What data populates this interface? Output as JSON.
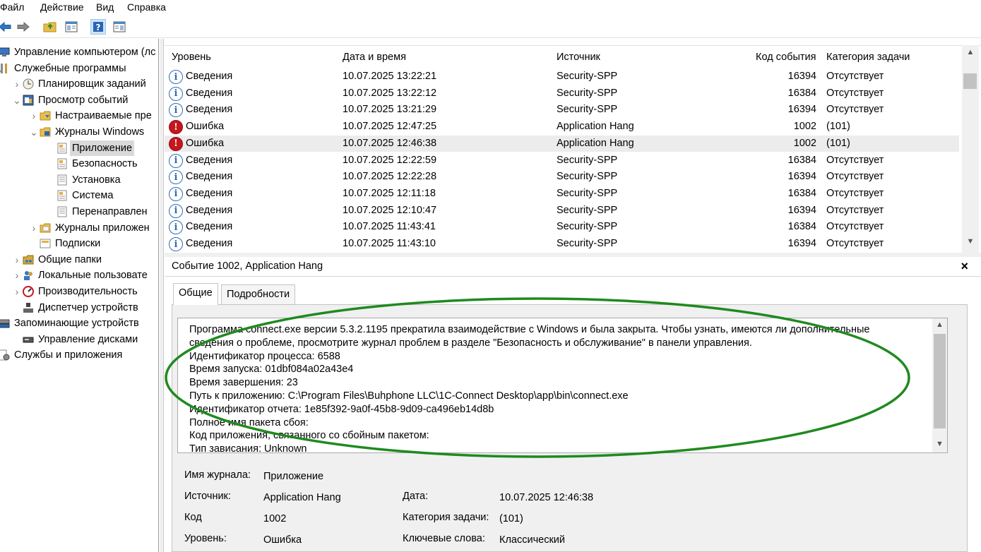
{
  "menu": [
    "Файл",
    "Действие",
    "Вид",
    "Справка"
  ],
  "tree": [
    {
      "label": "Управление компьютером (лс",
      "level": 0,
      "twisty": "",
      "icon": "computer-icon"
    },
    {
      "label": "Служебные программы",
      "level": 0,
      "twisty": "v",
      "icon": "tools-icon"
    },
    {
      "label": "Планировщик заданий",
      "level": 1,
      "twisty": ">",
      "icon": "clock-icon"
    },
    {
      "label": "Просмотр событий",
      "level": 1,
      "twisty": "v",
      "icon": "event-viewer-icon"
    },
    {
      "label": "Настраиваемые пре",
      "level": 2,
      "twisty": ">",
      "icon": "folder-filter-icon"
    },
    {
      "label": "Журналы Windows",
      "level": 2,
      "twisty": "v",
      "icon": "folder-windows-icon"
    },
    {
      "label": "Приложение",
      "level": 3,
      "twisty": "",
      "icon": "log-icon",
      "selected": true
    },
    {
      "label": "Безопасность",
      "level": 3,
      "twisty": "",
      "icon": "log-icon"
    },
    {
      "label": "Установка",
      "level": 3,
      "twisty": "",
      "icon": "log-plain-icon"
    },
    {
      "label": "Система",
      "level": 3,
      "twisty": "",
      "icon": "log-icon"
    },
    {
      "label": "Перенаправлен",
      "level": 3,
      "twisty": "",
      "icon": "log-plain-icon"
    },
    {
      "label": "Журналы приложен",
      "level": 2,
      "twisty": ">",
      "icon": "folder-icon"
    },
    {
      "label": "Подписки",
      "level": 2,
      "twisty": "",
      "icon": "subscriptions-icon"
    },
    {
      "label": "Общие папки",
      "level": 1,
      "twisty": ">",
      "icon": "shared-folders-icon"
    },
    {
      "label": "Локальные пользовате",
      "level": 1,
      "twisty": ">",
      "icon": "users-icon"
    },
    {
      "label": "Производительность",
      "level": 1,
      "twisty": ">",
      "icon": "performance-icon"
    },
    {
      "label": "Диспетчер устройств",
      "level": 1,
      "twisty": "",
      "icon": "device-manager-icon"
    },
    {
      "label": "Запоминающие устройств",
      "level": 0,
      "twisty": "v",
      "icon": "storage-icon"
    },
    {
      "label": "Управление дисками",
      "level": 1,
      "twisty": "",
      "icon": "disk-icon"
    },
    {
      "label": "Службы и приложения",
      "level": 0,
      "twisty": ">",
      "icon": "services-icon"
    }
  ],
  "columns": {
    "level": "Уровень",
    "datetime": "Дата и время",
    "source": "Источник",
    "code": "Код события",
    "category": "Категория задачи"
  },
  "events": [
    {
      "type": "info",
      "level": "Сведения",
      "datetime": "10.07.2025 13:22:21",
      "source": "Security-SPP",
      "code": "16394",
      "category": "Отсутствует"
    },
    {
      "type": "info",
      "level": "Сведения",
      "datetime": "10.07.2025 13:22:12",
      "source": "Security-SPP",
      "code": "16384",
      "category": "Отсутствует"
    },
    {
      "type": "info",
      "level": "Сведения",
      "datetime": "10.07.2025 13:21:29",
      "source": "Security-SPP",
      "code": "16394",
      "category": "Отсутствует"
    },
    {
      "type": "error",
      "level": "Ошибка",
      "datetime": "10.07.2025 12:47:25",
      "source": "Application Hang",
      "code": "1002",
      "category": "(101)"
    },
    {
      "type": "error",
      "level": "Ошибка",
      "datetime": "10.07.2025 12:46:38",
      "source": "Application Hang",
      "code": "1002",
      "category": "(101)",
      "selected": true
    },
    {
      "type": "info",
      "level": "Сведения",
      "datetime": "10.07.2025 12:22:59",
      "source": "Security-SPP",
      "code": "16384",
      "category": "Отсутствует"
    },
    {
      "type": "info",
      "level": "Сведения",
      "datetime": "10.07.2025 12:22:28",
      "source": "Security-SPP",
      "code": "16394",
      "category": "Отсутствует"
    },
    {
      "type": "info",
      "level": "Сведения",
      "datetime": "10.07.2025 12:11:18",
      "source": "Security-SPP",
      "code": "16384",
      "category": "Отсутствует"
    },
    {
      "type": "info",
      "level": "Сведения",
      "datetime": "10.07.2025 12:10:47",
      "source": "Security-SPP",
      "code": "16394",
      "category": "Отсутствует"
    },
    {
      "type": "info",
      "level": "Сведения",
      "datetime": "10.07.2025 11:43:41",
      "source": "Security-SPP",
      "code": "16384",
      "category": "Отсутствует"
    },
    {
      "type": "info",
      "level": "Сведения",
      "datetime": "10.07.2025 11:43:10",
      "source": "Security-SPP",
      "code": "16394",
      "category": "Отсутствует"
    }
  ],
  "detail": {
    "title": "Событие 1002, Application Hang",
    "close": "×",
    "tabs": [
      "Общие",
      "Подробности"
    ],
    "description": [
      "Программа connect.exe версии 5.3.2.1195 прекратила взаимодействие с Windows и была закрыта. Чтобы узнать, имеются ли дополнительные",
      "сведения о проблеме, просмотрите журнал проблем в разделе \"Безопасность и обслуживание\" в панели управления.",
      "Идентификатор процесса: 6588",
      "Время запуска: 01dbf084a02a43e4",
      "Время завершения: 23",
      "Путь к приложению: C:\\Program Files\\Buhphone LLC\\1C-Connect Desktop\\app\\bin\\connect.exe",
      "Идентификатор отчета: 1e85f392-9a0f-45b8-9d09-ca496eb14d8b",
      "Полное имя пакета сбоя:",
      "Код приложения, связанного со сбойным пакетом:",
      "Тип зависания: Unknown"
    ],
    "props": {
      "log_label": "Имя журнала:",
      "log_value": "Приложение",
      "source_label": "Источник:",
      "source_value": "Application Hang",
      "date_label": "Дата:",
      "date_value": "10.07.2025 12:46:38",
      "code_label": "Код",
      "code_value": "1002",
      "category_label": "Категория задачи:",
      "category_value": "(101)",
      "level_label": "Уровень:",
      "level_value": "Ошибка",
      "keywords_label": "Ключевые слова:",
      "keywords_value": "Классический"
    }
  },
  "annotation_color": "#1f8a1f"
}
